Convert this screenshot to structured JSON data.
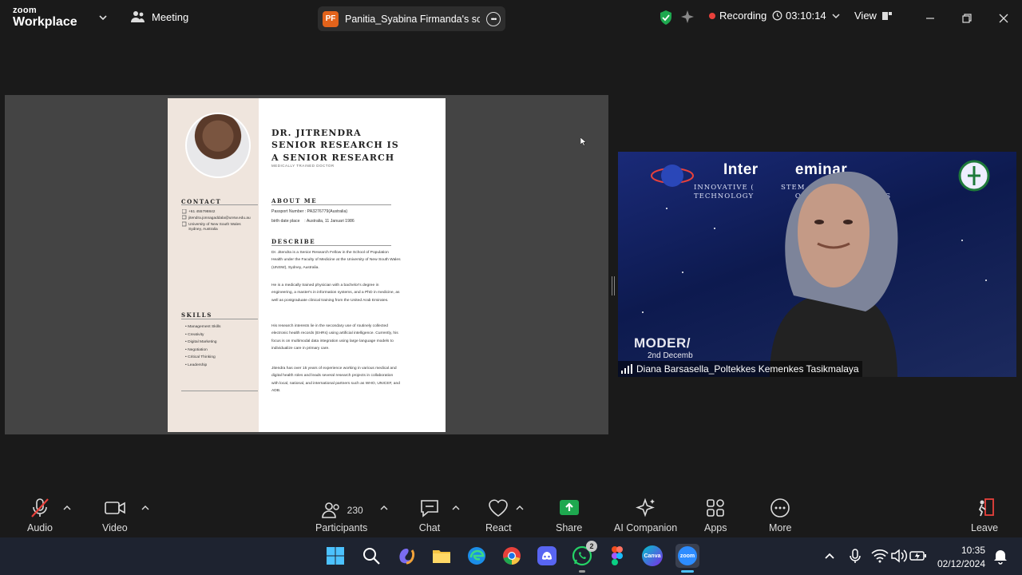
{
  "app": {
    "brand_small": "zoom",
    "brand_large": "Workplace"
  },
  "header": {
    "meeting_label": "Meeting",
    "share_initials": "PF",
    "share_name": "Panitia_Syabina Firmanda's screen",
    "recording_label": "Recording",
    "timer": "03:10:14",
    "view_label": "View"
  },
  "document": {
    "name_line1": "DR. JITRENDRA",
    "name_line2": "SENIOR RESEARCH IS",
    "name_line3": "A SENIOR RESEARCH",
    "subtitle": "MEDICALLY TRAINED DOCTOR",
    "contact_heading": "CONTACT",
    "contact_phone": "+61 455798842",
    "contact_email": "jitendra.jonnagaddala@unsw.edu.au",
    "contact_address": "University of New South Wales Sydney, Australia",
    "about_heading": "ABOUT ME",
    "passport": "Passport Number : PA3276779(Australia)",
    "birth": "birth date place    : Australia, 11 Januari 1986",
    "describe_heading": "DESCRIBE",
    "para1": "Dr. Jitendra is a Senior Research Fellow in the School of Population Health under the Faculty of Medicine at the University of New South Wales (UNSW), Sydney, Australia.",
    "para2": "He is a medically trained physician with a bachelor's degree in engineering, a master's in information systems, and a PhD in medicine, as well as postgraduate clinical training from the United Arab Emirates.",
    "para3": "His research interests lie in the secondary use of routinely collected electronic health records (EHRs) using artificial intelligence. Currently, his focus is on multimodal data integration using large language models to individualize care in primary care.",
    "para4": "Jitendra has over 15 years of experience working in various medical and digital health roles and leads several research projects in collaboration with local, national, and international partners such as WHO, UNICEF, and ADB.",
    "skills_heading": "SKILLS",
    "skills": [
      "Management Skills",
      "Creativity",
      "Digital Marketing",
      "Negotiation",
      "Critical Thinking",
      "Leadership"
    ]
  },
  "video": {
    "title": "Inter        eminar",
    "sub_line1": "INNOVATIVE (         STEM : INTEGRATING",
    "sub_line2": "TECHNOLOGY              OF HEALTH SERVICES",
    "modern": "MODER/",
    "date": "2nd Decemb",
    "participant_name": "Diana Barsasella_Poltekkes Kemenkes Tasikmalaya"
  },
  "toolbar": {
    "audio": "Audio",
    "video": "Video",
    "participants": "Participants",
    "participants_count": "230",
    "chat": "Chat",
    "react": "React",
    "share": "Share",
    "ai": "AI Companion",
    "apps": "Apps",
    "more": "More",
    "leave": "Leave"
  },
  "taskbar": {
    "whatsapp_badge": "2",
    "canva_label": "Canva",
    "zoom_label": "zoom",
    "time": "10:35",
    "date": "02/12/2024"
  },
  "colors": {
    "accent_green": "#1ea84f",
    "recording_red": "#e8413b",
    "leave_red": "#e8413b",
    "share_orange": "#e2631b"
  }
}
